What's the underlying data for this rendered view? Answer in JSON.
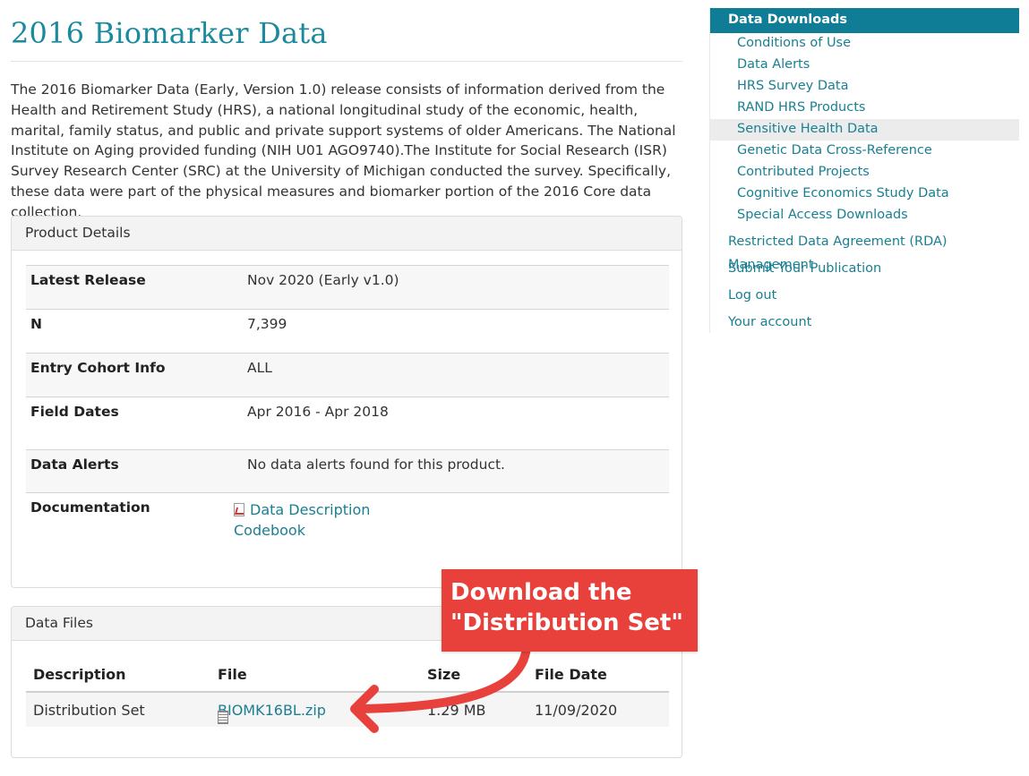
{
  "page": {
    "title": "2016 Biomarker Data",
    "intro": "The 2016 Biomarker Data (Early, Version 1.0) release consists of information derived from the Health and Retirement Study (HRS), a national longitudinal study of the economic, health, marital, family status, and public and private support systems of older Americans. The National Institute on Aging provided funding (NIH U01 AGO9740).The Institute for Social Research (ISR) Survey Research Center (SRC) at the University of Michigan conducted the survey. Specifically, these data were part of the physical measures and biomarker portion of the 2016 Core data collection."
  },
  "product_details": {
    "heading": "Product Details",
    "rows": [
      {
        "label": "Latest Release",
        "value": "Nov 2020 (Early v1.0)"
      },
      {
        "label": "N",
        "value": "7,399"
      },
      {
        "label": "Entry Cohort Info",
        "value": "ALL"
      },
      {
        "label": "Field Dates",
        "value": "Apr 2016 - Apr 2018"
      },
      {
        "label": "Data Alerts",
        "value": "No data alerts found for this product."
      },
      {
        "label": "Documentation",
        "links": [
          "Data Description",
          "Codebook"
        ]
      }
    ]
  },
  "data_files": {
    "heading": "Data Files",
    "columns": [
      "Description",
      "File",
      "Size",
      "File Date"
    ],
    "rows": [
      {
        "description": "Distribution Set",
        "file": "BIOMK16BL.zip",
        "size": "1.29 MB",
        "date": "11/09/2020"
      }
    ]
  },
  "sidebar": {
    "heading": "Data Downloads",
    "subitems": [
      "Conditions of Use",
      "Data Alerts",
      "HRS Survey Data",
      "RAND HRS Products",
      "Sensitive Health Data",
      "Genetic Data Cross-Reference",
      "Contributed Projects",
      "Cognitive Economics Study Data",
      "Special Access Downloads"
    ],
    "active_item": "Sensitive Health Data",
    "top_items": [
      "Restricted Data Agreement (RDA) Management",
      "Submit Your Publication",
      "Log out",
      "Your account"
    ]
  },
  "callout": {
    "line1": "Download the",
    "line2": "\"Distribution Set\""
  },
  "colors": {
    "accent": "#0f7d96",
    "link": "#1a7f91",
    "callout": "#e8403a"
  }
}
